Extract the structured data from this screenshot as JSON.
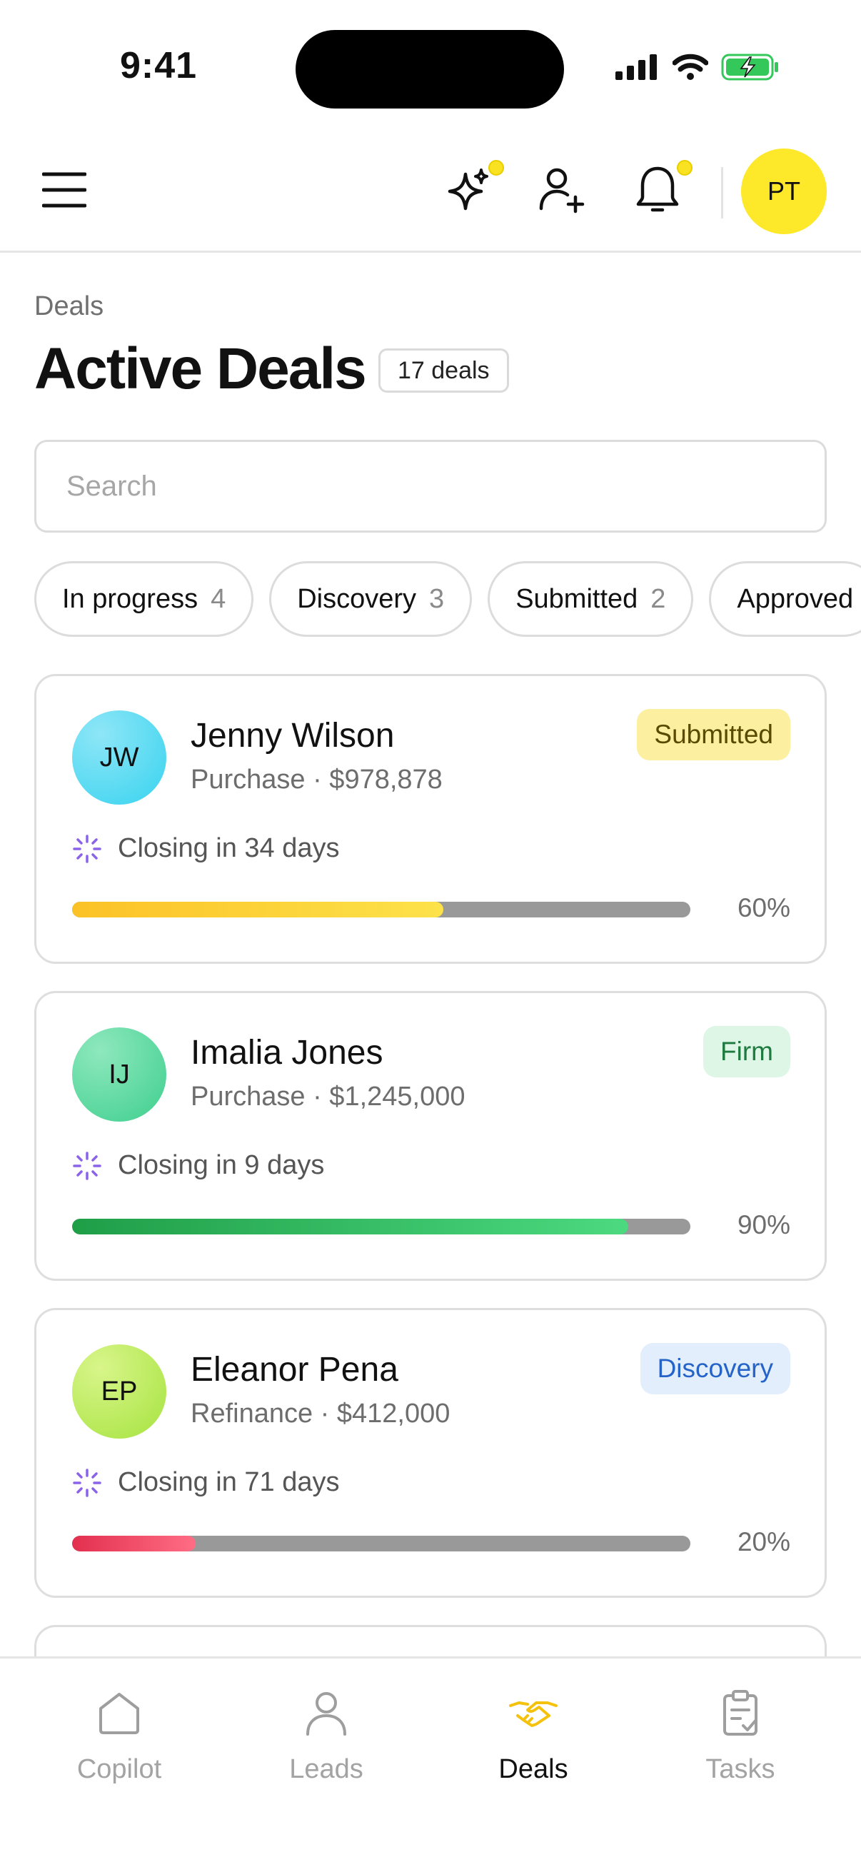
{
  "status_bar": {
    "time": "9:41"
  },
  "header": {
    "avatar_initials": "PT"
  },
  "breadcrumb": "Deals",
  "title": "Active Deals",
  "deal_count": "17 deals",
  "search": {
    "placeholder": "Search",
    "value": ""
  },
  "filters": [
    {
      "label": "In progress",
      "count": "4"
    },
    {
      "label": "Discovery",
      "count": "3"
    },
    {
      "label": "Submitted",
      "count": "2"
    },
    {
      "label": "Approved",
      "count": ""
    }
  ],
  "deals": [
    {
      "initials": "JW",
      "name": "Jenny Wilson",
      "subtitle": "Purchase · $978,878",
      "status": "Submitted",
      "closing": "Closing in 34 days",
      "progress": 0.6,
      "progress_label": "60%"
    },
    {
      "initials": "IJ",
      "name": "Imalia Jones",
      "subtitle": "Purchase · $1,245,000",
      "status": "Firm",
      "closing": "Closing in 9 days",
      "progress": 0.9,
      "progress_label": "90%"
    },
    {
      "initials": "EP",
      "name": "Eleanor Pena",
      "subtitle": "Refinance · $412,000",
      "status": "Discovery",
      "closing": "Closing in 71 days",
      "progress": 0.2,
      "progress_label": "20%"
    }
  ],
  "tabs": [
    {
      "label": "Copilot",
      "icon": "home-icon"
    },
    {
      "label": "Leads",
      "icon": "person-icon"
    },
    {
      "label": "Deals",
      "icon": "handshake-icon",
      "active": true
    },
    {
      "label": "Tasks",
      "icon": "clipboard-check-icon"
    }
  ],
  "colors": {
    "accent": "#FDE82A",
    "submitted_bg": "#FCF0A0",
    "submitted_text": "#5A4A00",
    "firm_bg": "#DDF6E6",
    "firm_text": "#1E7A3F",
    "discovery_bg": "#E2EEFB",
    "discovery_text": "#2563C9",
    "progress_yellow": "#FBC62B",
    "progress_green": "#22A34D",
    "progress_red": "#E83A5A"
  }
}
